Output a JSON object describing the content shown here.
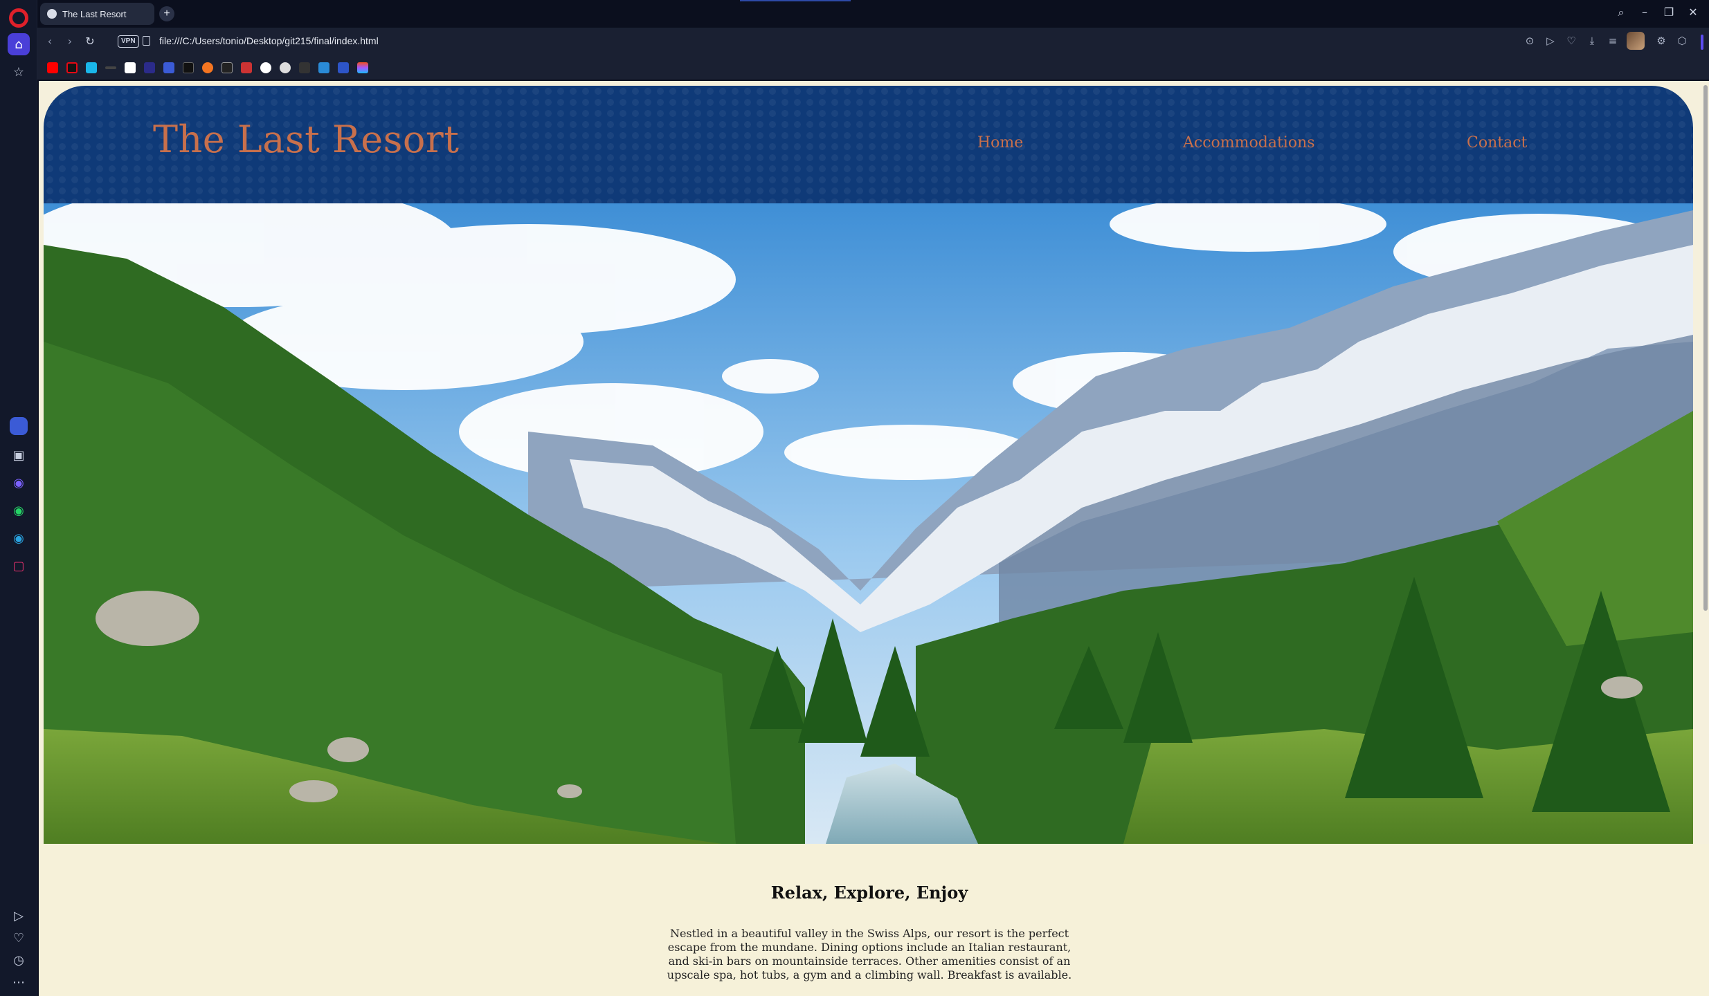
{
  "browser": {
    "tab_title": "The Last Resort",
    "new_tab_symbol": "+",
    "url": "file:///C:/Users/tonio/Desktop/git215/final/index.html",
    "vpn_label": "VPN",
    "window_controls": {
      "search": "⌕",
      "minimize": "–",
      "restore": "❐",
      "close": "✕"
    },
    "nav": {
      "back": "‹",
      "forward": "›",
      "reload": "↻"
    }
  },
  "site": {
    "brand": "The Last Resort",
    "nav": [
      "Home",
      "Accommodations",
      "Contact"
    ],
    "intro_title": "Relax, Explore, Enjoy",
    "intro_text": "Nestled in a beautiful valley in the Swiss Alps, our resort is the perfect escape from the mundane. Dining options include an Italian restaurant, and ski-in bars on mountainside terraces. Other amenities consist of an upscale spa, hot tubs, a gym and a climbing wall. Breakfast is available.",
    "colors": {
      "header": "#0f3a78",
      "brand": "#c8704c",
      "cream": "#f6f1d9"
    }
  },
  "bookmark_icons": [
    "youtube-icon",
    "netflix-icon",
    "vimeo-icon",
    "bookmark-icon",
    "amazon-icon",
    "bookmark-icon",
    "mastodon-icon",
    "bookmark-icon",
    "crunchyroll-icon",
    "bookmark-icon",
    "bookmark-icon",
    "github-icon",
    "chatgpt-icon",
    "bookmark-icon",
    "bookmark-icon",
    "bookmark-icon",
    "figma-icon"
  ]
}
